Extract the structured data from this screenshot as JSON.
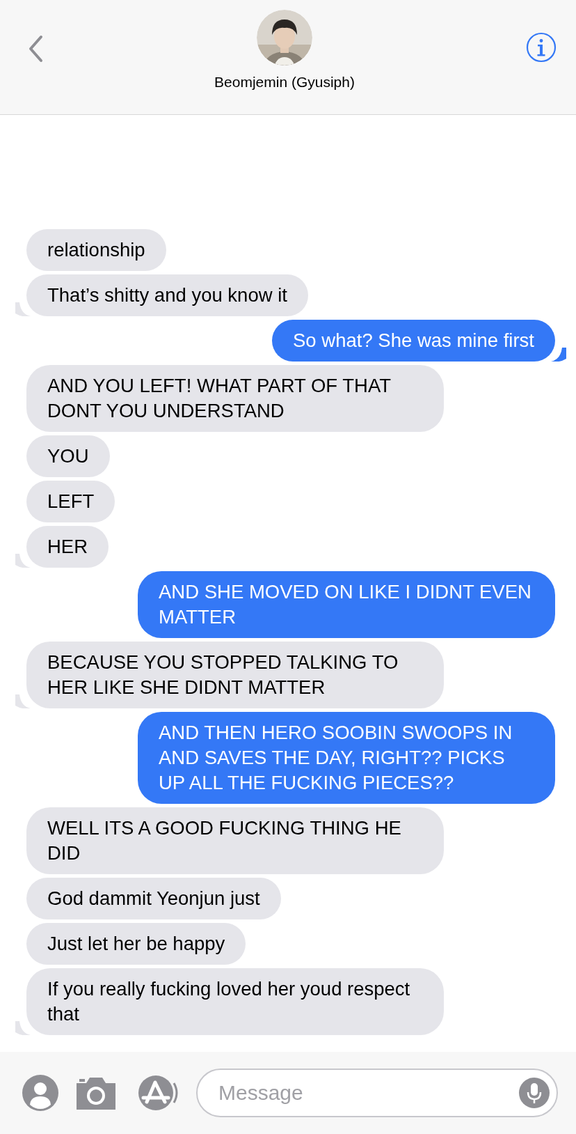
{
  "header": {
    "contact_name": "Beomjemin (Gyusiph)"
  },
  "messages": [
    {
      "outgoing": false,
      "text": "relationship",
      "tail": false
    },
    {
      "outgoing": false,
      "text": "That’s shitty and you know it",
      "tail": true
    },
    {
      "outgoing": true,
      "text": "So what? She was mine first",
      "tail": true
    },
    {
      "outgoing": false,
      "text": "AND YOU LEFT! WHAT PART OF THAT DONT YOU UNDERSTAND",
      "tail": false
    },
    {
      "outgoing": false,
      "text": "YOU",
      "tail": false
    },
    {
      "outgoing": false,
      "text": "LEFT",
      "tail": false
    },
    {
      "outgoing": false,
      "text": "HER",
      "tail": true
    },
    {
      "outgoing": true,
      "text": "AND SHE MOVED ON LIKE I DIDNT EVEN MATTER",
      "tail": false
    },
    {
      "outgoing": false,
      "text": "BECAUSE YOU STOPPED TALKING TO HER LIKE SHE DIDNT MATTER",
      "tail": true
    },
    {
      "outgoing": true,
      "text": "AND THEN HERO SOOBIN SWOOPS IN AND SAVES THE DAY, RIGHT?? PICKS UP ALL THE FUCKING PIECES??",
      "tail": false
    },
    {
      "outgoing": false,
      "text": "WELL ITS A GOOD FUCKING THING HE DID",
      "tail": false
    },
    {
      "outgoing": false,
      "text": "God dammit Yeonjun just",
      "tail": false
    },
    {
      "outgoing": false,
      "text": "Just let her be happy",
      "tail": false
    },
    {
      "outgoing": false,
      "text": "If you really fucking loved her youd respect that",
      "tail": true
    }
  ],
  "composer": {
    "placeholder": "Message"
  }
}
